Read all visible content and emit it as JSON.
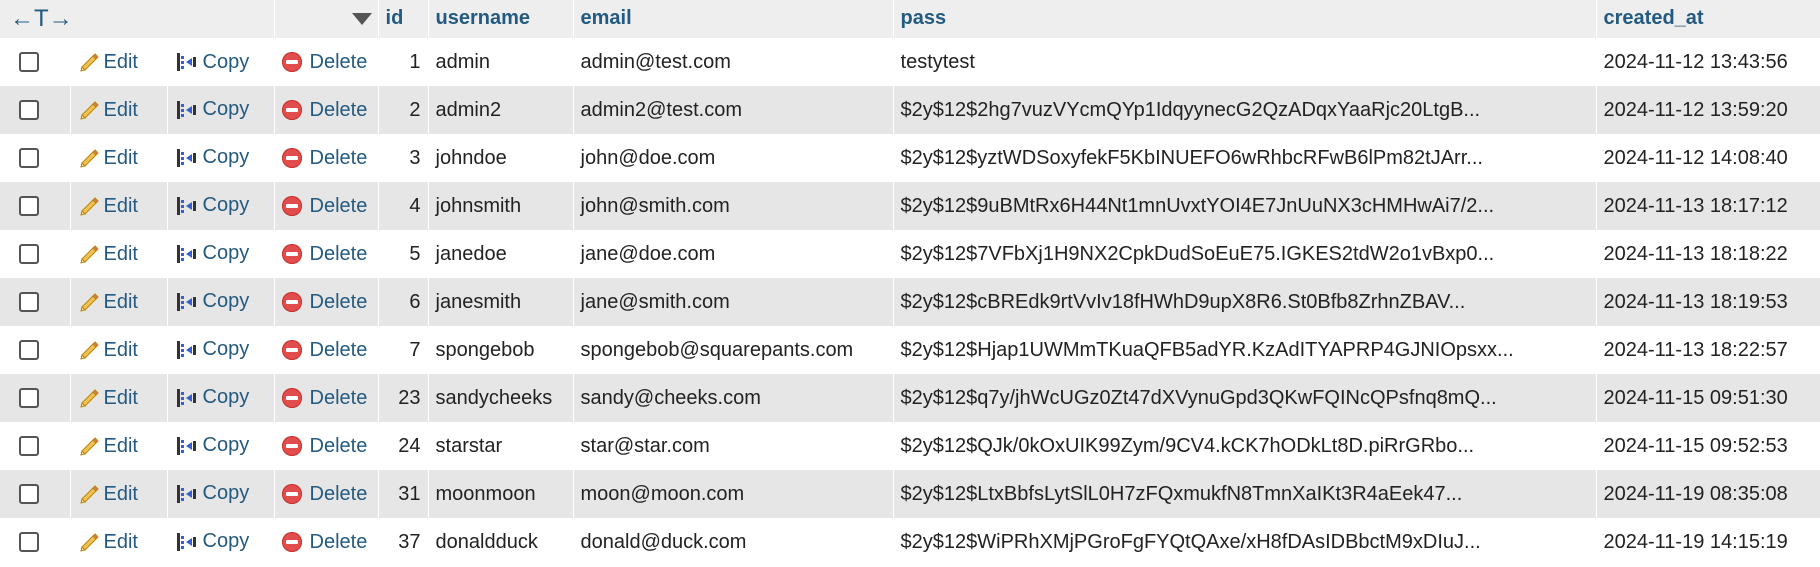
{
  "header": {
    "nav_arrows": "←T→",
    "columns": [
      "id",
      "username",
      "email",
      "pass",
      "created_at"
    ]
  },
  "actions": {
    "edit": "Edit",
    "copy": "Copy",
    "delete": "Delete"
  },
  "rows": [
    {
      "id": "1",
      "username": "admin",
      "email": "admin@test.com",
      "pass": "testytest",
      "created_at": "2024-11-12 13:43:56"
    },
    {
      "id": "2",
      "username": "admin2",
      "email": "admin2@test.com",
      "pass": "$2y$12$2hg7vuzVYcmQYp1IdqyynecG2QzADqxYaaRjc20LtgB...",
      "created_at": "2024-11-12 13:59:20"
    },
    {
      "id": "3",
      "username": "johndoe",
      "email": "john@doe.com",
      "pass": "$2y$12$yztWDSoxyfekF5KbINUEFO6wRhbcRFwB6lPm82tJArr...",
      "created_at": "2024-11-12 14:08:40"
    },
    {
      "id": "4",
      "username": "johnsmith",
      "email": "john@smith.com",
      "pass": "$2y$12$9uBMtRx6H44Nt1mnUvxtYOI4E7JnUuNX3cHMHwAi7/2...",
      "created_at": "2024-11-13 18:17:12"
    },
    {
      "id": "5",
      "username": "janedoe",
      "email": "jane@doe.com",
      "pass": "$2y$12$7VFbXj1H9NX2CpkDudSoEuE75.IGKES2tdW2o1vBxp0...",
      "created_at": "2024-11-13 18:18:22"
    },
    {
      "id": "6",
      "username": "janesmith",
      "email": "jane@smith.com",
      "pass": "$2y$12$cBREdk9rtVvIv18fHWhD9upX8R6.St0Bfb8ZrhnZBAV...",
      "created_at": "2024-11-13 18:19:53"
    },
    {
      "id": "7",
      "username": "spongebob",
      "email": "spongebob@squarepants.com",
      "pass": "$2y$12$Hjap1UWMmTKuaQFB5adYR.KzAdITYAPRP4GJNIOpsxx...",
      "created_at": "2024-11-13 18:22:57"
    },
    {
      "id": "23",
      "username": "sandycheeks",
      "email": "sandy@cheeks.com",
      "pass": "$2y$12$q7y/jhWcUGz0Zt47dXVynuGpd3QKwFQINcQPsfnq8mQ...",
      "created_at": "2024-11-15 09:51:30"
    },
    {
      "id": "24",
      "username": "starstar",
      "email": "star@star.com",
      "pass": "$2y$12$QJk/0kOxUIK99Zym/9CV4.kCK7hODkLt8D.piRrGRbo...",
      "created_at": "2024-11-15 09:52:53"
    },
    {
      "id": "31",
      "username": "moonmoon",
      "email": "moon@moon.com",
      "pass": "$2y$12$LtxBbfsLytSlL0H7zFQxmukfN8TmnXaIKt3R4aEek47...",
      "created_at": "2024-11-19 08:35:08"
    },
    {
      "id": "37",
      "username": "donaldduck",
      "email": "donald@duck.com",
      "pass": "$2y$12$WiPRhXMjPGroFgFYQtQAxe/xH8fDAsIDBbctM9xDIuJ...",
      "created_at": "2024-11-19 14:15:19"
    }
  ]
}
